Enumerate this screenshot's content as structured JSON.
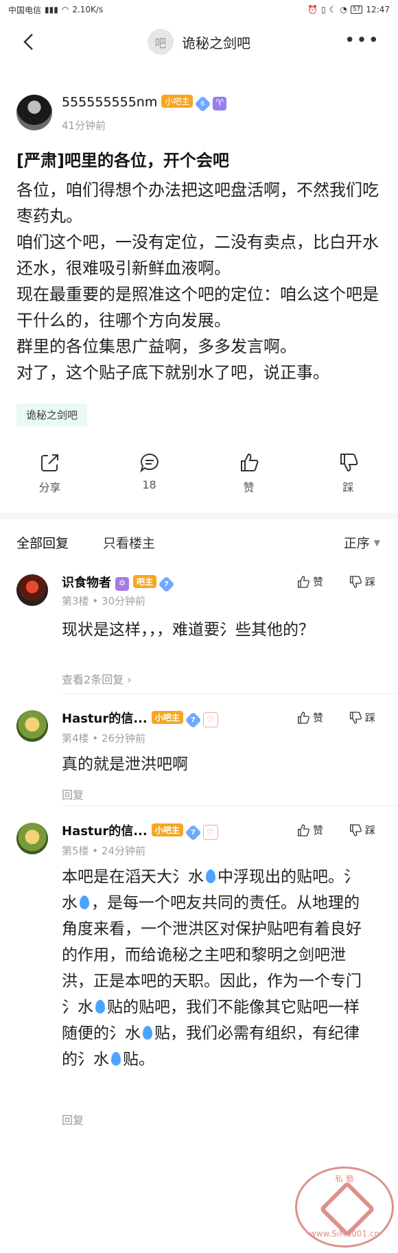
{
  "status": {
    "carrier": "中国电信",
    "speed": "2.10K/s",
    "battery": "57",
    "time": "12:47"
  },
  "forum": {
    "avatar_text": "吧",
    "name": "诡秘之剑吧"
  },
  "post": {
    "author": "555555555nm",
    "author_badge": "小吧主",
    "level": "6",
    "zodiac": "♈",
    "time": "41分钟前",
    "title": "[严肃]吧里的各位，开个会吧",
    "body": "各位，咱们得想个办法把这吧盘活啊，不然我们吃枣药丸。\n咱们这个吧，一没有定位，二没有卖点，比白开水还水，很难吸引新鲜血液啊。\n现在最重要的是照准这个吧的定位：咱么这个吧是干什么的，往哪个方向发展。\n群里的各位集思广益啊，多多发言啊。\n对了，这个贴子底下就别水了吧，说正事。",
    "tag": "诡秘之剑吧"
  },
  "actions": {
    "share": "分享",
    "comments": "18",
    "like": "赞",
    "dislike": "踩"
  },
  "tabs": {
    "all": "全部回复",
    "host_only": "只看楼主",
    "sort": "正序"
  },
  "replies": [
    {
      "name": "识食物者",
      "badge": "吧主",
      "level": "7",
      "zodiac": "✡",
      "meta": "第3楼 • 30分钟前",
      "text": "现状是这样，，，难道要氵些其他的？",
      "link": "查看2条回复 ›",
      "like": "赞",
      "dislike": "踩"
    },
    {
      "name": "Hastur的信...",
      "badge": "小吧主",
      "level": "7",
      "meta": "第4楼 • 26分钟前",
      "text": "真的就是泄洪吧啊",
      "link": "回复",
      "like": "赞",
      "dislike": "踩"
    },
    {
      "name": "Hastur的信...",
      "badge": "小吧主",
      "level": "7",
      "meta": "第5楼 • 24分钟前",
      "text_parts": [
        "本吧是在滔天大氵水",
        "中浮现出的贴吧。氵水",
        "，是每一个吧友共同的责任。从地理的角度来看，一个泄洪区对保护贴吧有着良好的作用，而给诡秘之主吧和黎明之剑吧泄洪，正是本吧的天职。因此，作为一个专门氵水",
        "贴的贴吧，我们不能像其它贴吧一样随便的氵水",
        "贴，我们必需有组织，有纪律的氵水",
        "贴。"
      ],
      "link": "回复",
      "like": "赞",
      "dislike": "踩"
    }
  ],
  "watermark": {
    "top": "私 塾",
    "bottom": "www.SiMu001.cn"
  }
}
